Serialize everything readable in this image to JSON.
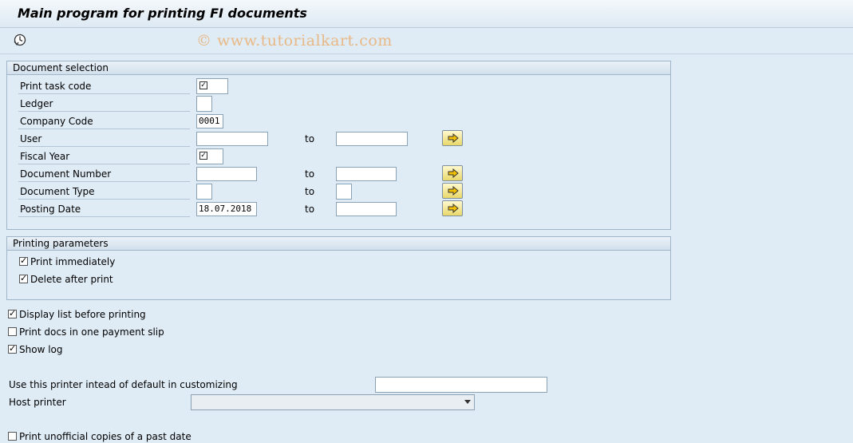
{
  "window": {
    "title": "Main program for printing FI documents"
  },
  "toolbar": {
    "execute_icon": "clock-execute-icon",
    "watermark": "© www.tutorialkart.com"
  },
  "doc_selection": {
    "heading": "Document selection",
    "to_label": "to",
    "rows": {
      "print_task_code": {
        "label": "Print task code"
      },
      "ledger": {
        "label": "Ledger"
      },
      "company_code": {
        "label": "Company Code",
        "value": "0001"
      },
      "user": {
        "label": "User"
      },
      "fiscal_year": {
        "label": "Fiscal Year"
      },
      "document_number": {
        "label": "Document Number"
      },
      "document_type": {
        "label": "Document Type"
      },
      "posting_date": {
        "label": "Posting Date",
        "value": "18.07.2018"
      }
    }
  },
  "printing_params": {
    "heading": "Printing parameters",
    "print_immediately": {
      "label": "Print immediately",
      "checked": true
    },
    "delete_after_print": {
      "label": "Delete after print",
      "checked": true
    }
  },
  "options": {
    "display_list": {
      "label": "Display list before printing",
      "checked": true
    },
    "print_docs_one_slip": {
      "label": "Print docs in one payment slip",
      "checked": false
    },
    "show_log": {
      "label": "Show log",
      "checked": true
    }
  },
  "printer": {
    "use_printer_label": "Use this printer intead of default in customizing",
    "use_printer_value": "",
    "host_printer_label": "Host printer",
    "host_printer_value": ""
  },
  "unofficial": {
    "label": "Print unofficial copies of a past date",
    "checked": false
  }
}
